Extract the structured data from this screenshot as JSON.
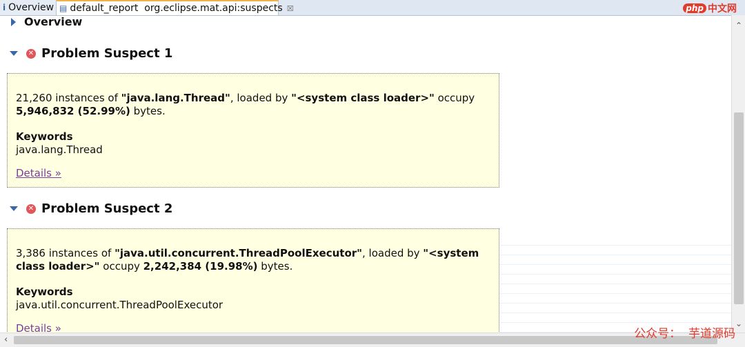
{
  "tabs": [
    {
      "icon": "info-icon",
      "label": "Overview"
    },
    {
      "icon": "report-icon",
      "label": "default_report  org.eclipse.mat.api:suspects",
      "close": "☒"
    }
  ],
  "brand": {
    "php": "php",
    "text": "中文网"
  },
  "overview_heading": "Overview",
  "suspects": [
    {
      "title": "Problem Suspect 1",
      "count": "21,260",
      "text_instances_of": " instances of ",
      "class_name": "\"java.lang.Thread\"",
      "text_loaded_by": ", loaded by ",
      "loader": "\"<system class loader>\"",
      "text_occupy": " occupy",
      "bytes": "5,946,832 (52.99%)",
      "text_bytes": " bytes.",
      "keywords_label": "Keywords",
      "keyword": "java.lang.Thread",
      "details": "Details »"
    },
    {
      "title": "Problem Suspect 2",
      "count": "3,386",
      "text_instances_of": " instances of ",
      "class_name": "\"java.util.concurrent.ThreadPoolExecutor\"",
      "text_loaded_by": ", loaded by ",
      "loader": "\"<system class loader>\"",
      "text_occupy": " occupy ",
      "bytes": "2,242,384 (19.98%)",
      "text_bytes": " bytes.",
      "keywords_label": "Keywords",
      "keyword": "java.util.concurrent.ThreadPoolExecutor",
      "details": "Details »"
    }
  ],
  "watermark": "公众号：  芋道源码"
}
